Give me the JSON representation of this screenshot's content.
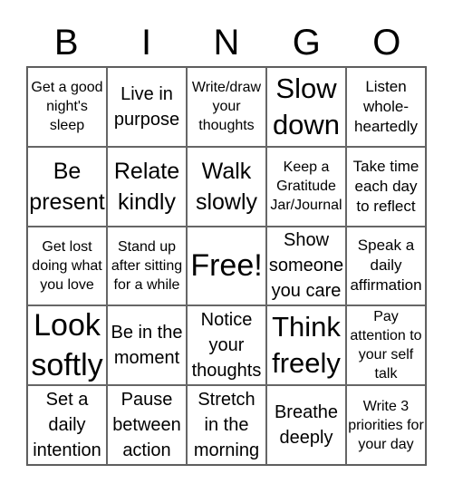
{
  "header": {
    "letters": [
      "B",
      "I",
      "N",
      "G",
      "O"
    ]
  },
  "board": {
    "rows": [
      [
        {
          "text": "Get a good night's sleep"
        },
        {
          "text": "Live in purpose"
        },
        {
          "text": "Write/draw your thoughts"
        },
        {
          "text": "Slow down"
        },
        {
          "text": "Listen whole-heartedly"
        }
      ],
      [
        {
          "text": "Be present"
        },
        {
          "text": "Relate kindly"
        },
        {
          "text": "Walk slowly"
        },
        {
          "text": "Keep a Gratitude Jar/Journal"
        },
        {
          "text": "Take time each day to reflect"
        }
      ],
      [
        {
          "text": "Get lost doing what you love"
        },
        {
          "text": "Stand up after sitting for a while"
        },
        {
          "text": "Free!"
        },
        {
          "text": "Show someone you care"
        },
        {
          "text": "Speak a daily affirmation"
        }
      ],
      [
        {
          "text": "Look softly"
        },
        {
          "text": "Be in the moment"
        },
        {
          "text": "Notice your thoughts"
        },
        {
          "text": "Think freely"
        },
        {
          "text": "Pay attention to your self talk"
        }
      ],
      [
        {
          "text": "Set a daily intention"
        },
        {
          "text": "Pause between action"
        },
        {
          "text": "Stretch in the morning"
        },
        {
          "text": "Breathe deeply"
        },
        {
          "text": "Write 3 priorities for your day"
        }
      ]
    ]
  }
}
